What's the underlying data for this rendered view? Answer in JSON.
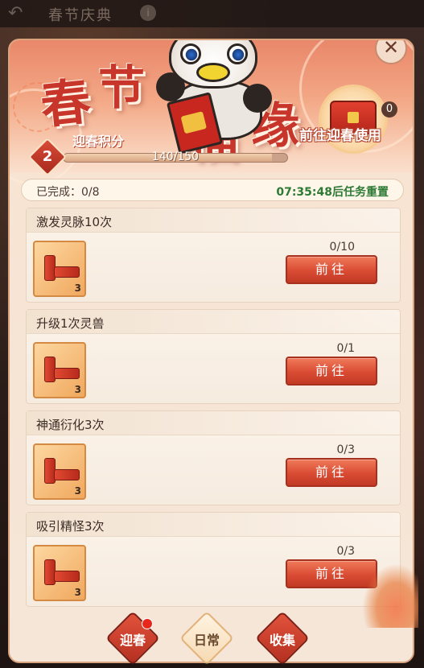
{
  "top_bar": {
    "back_icon": "back-arrow-icon",
    "title": "春节庆典",
    "info_icon": "info-icon"
  },
  "header": {
    "title_chars": [
      "春",
      "节",
      "福",
      "缘"
    ],
    "score_label": "迎春积分",
    "level": "2",
    "progress_text": "140/150",
    "progress_fraction": 0.933,
    "chest_count": "0",
    "chest_link": "前往迎春使用",
    "close_icon": "close-icon"
  },
  "status": {
    "completed": "已完成：0/8",
    "reset_timer": "07:35:48后任务重置"
  },
  "tasks": [
    {
      "title": "激发灵脉10次",
      "progress": "0/10",
      "reward_qty": "3",
      "button": "前往"
    },
    {
      "title": "升级1次灵兽",
      "progress": "0/1",
      "reward_qty": "3",
      "button": "前往"
    },
    {
      "title": "神通衍化3次",
      "progress": "0/3",
      "reward_qty": "3",
      "button": "前往"
    },
    {
      "title": "吸引精怪3次",
      "progress": "0/3",
      "reward_qty": "3",
      "button": "前往"
    }
  ],
  "tabs": [
    {
      "label": "迎春",
      "active": false,
      "badge": true
    },
    {
      "label": "日常",
      "active": true,
      "badge": false
    },
    {
      "label": "收集",
      "active": false,
      "badge": false
    }
  ],
  "colors": {
    "accent_red": "#d94b33",
    "timer_green": "#2c7a34",
    "panel_bg": "#f7e4d3"
  }
}
